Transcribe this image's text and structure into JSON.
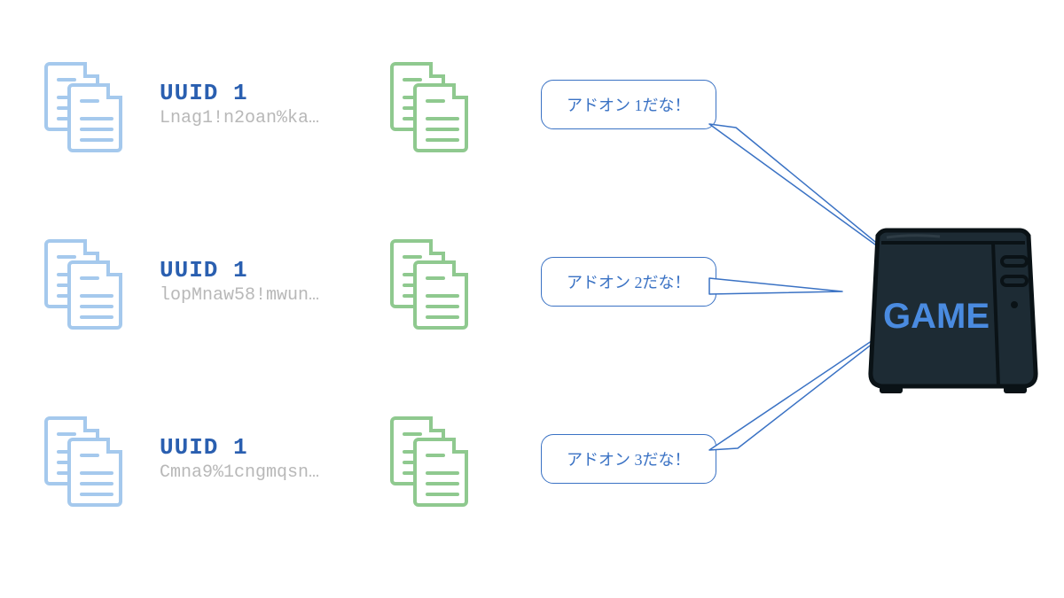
{
  "rows": [
    {
      "uuid_label": "UUID 1",
      "uuid_value": "Lnag1!n2oan%ka…",
      "bubble": "アドオン 1だな！"
    },
    {
      "uuid_label": "UUID 1",
      "uuid_value": "lopMnaw58!mwun…",
      "bubble": "アドオン 2だな！"
    },
    {
      "uuid_label": "UUID 1",
      "uuid_value": "Cmna9%1cngmqsn…",
      "bubble": "アドオン 3だな！"
    }
  ],
  "console_label": "GAME"
}
